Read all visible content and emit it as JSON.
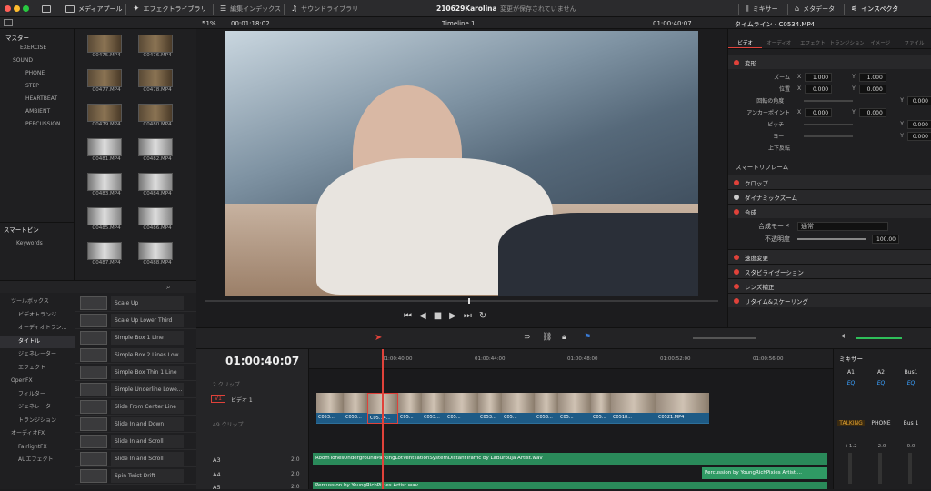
{
  "topbar": {
    "media_pool": "メディアプール",
    "effects_library": "エフェクトライブラリ",
    "edit_index": "編集インデックス",
    "sound_library": "サウンドライブラリ",
    "project_name": "210629Karolina",
    "save_status": "変更が保存されていません",
    "mixer": "ミキサー",
    "metadata": "メタデータ",
    "inspector": "インスペクタ"
  },
  "viewer": {
    "zoom": "51%",
    "source_timecode": "00:01:18:02",
    "timeline_name": "Timeline 1",
    "timecode": "01:00:40:07"
  },
  "inspector": {
    "title": "タイムライン - C0534.MP4",
    "tabs": [
      "ビデオ",
      "オーディオ",
      "エフェクト",
      "トランジション",
      "イメージ",
      "ファイル"
    ],
    "transform_label": "変形",
    "zoom_label": "ズーム",
    "zoom_x": "1.000",
    "zoom_y": "1.000",
    "position_label": "位置",
    "pos_x": "0.000",
    "pos_y": "0.000",
    "rotation_label": "回転の角度",
    "rotation": "0.000",
    "anchor_label": "アンカーポイント",
    "anchor_x": "0.000",
    "anchor_y": "0.000",
    "pitch_label": "ピッチ",
    "pitch": "0.000",
    "yaw_label": "ヨー",
    "yaw": "0.000",
    "flip_label": "上下反転",
    "smart_reframe": "スマートリフレーム",
    "crop": "クロップ",
    "dynamic_zoom": "ダイナミックズーム",
    "composite": "合成",
    "composite_mode_label": "合成モード",
    "composite_mode": "通常",
    "opacity_label": "不透明度",
    "opacity": "100.00",
    "speed_change": "速度変更",
    "stabilization": "スタビライゼーション",
    "lens_correction": "レンズ補正",
    "retime": "リタイム&スケーリング",
    "x_label": "X",
    "y_label": "Y"
  },
  "bins": {
    "master": "マスター",
    "items": [
      "EXERCISE",
      "SOUND",
      "PHONE",
      "STEP",
      "HEARTBEAT",
      "AMBIENT",
      "PERCUSSION"
    ],
    "smart_bins": "スマートビン",
    "keywords": "Keywords"
  },
  "media": [
    "C0475.MP4",
    "C0476.MP4",
    "C0477.MP4",
    "C0478.MP4",
    "C0479.MP4",
    "C0480.MP4",
    "C0481.MP4",
    "C0482.MP4",
    "C0483.MP4",
    "C0484.MP4",
    "C0485.MP4",
    "C0486.MP4",
    "C0487.MP4",
    "C0488.MP4"
  ],
  "fx_tree": [
    "ツールボックス",
    "ビデオトランジ...",
    "オーディオトラン...",
    "タイトル",
    "ジェネレーター",
    "エフェクト",
    "OpenFX",
    "フィルター",
    "ジェネレーター",
    "トランジション",
    "オーディオFX",
    "FairlightFX",
    "AUエフェクト"
  ],
  "fx_list": [
    "Scale Up",
    "Scale Up Lower Third",
    "Simple Box 1 Line Lowe...",
    "Simple Box 2 Lines Low...",
    "Simple Box Thin 1 Line ...",
    "Simple Underline Lowe...",
    "Slide From Center Line",
    "Slide In and Down",
    "Slide In and Scroll",
    "Slide In and Scroll Lowe...",
    "Spin Twist Drift"
  ],
  "timeline": {
    "timecode": "01:00:40:07",
    "ruler": [
      "01:00:40:00",
      "01:00:44:00",
      "01:00:48:00",
      "01:00:52:00",
      "01:00:56:00"
    ],
    "v2_clips": "2 クリップ",
    "v1_label": "V1",
    "v1_name": "ビデオ 1",
    "v1_clips": "49 クリップ",
    "video_clips": [
      "C053...",
      "C053...",
      "C05...4...",
      "C05...",
      "C053...",
      "C05...",
      "C053...",
      "C05...",
      "C053...",
      "C05...",
      "C05...",
      "C0518...",
      "C0521.MP4"
    ],
    "a3": "A3",
    "a4": "A4",
    "a5": "A5",
    "a3_clip": "RoomTonesUndergroundParkingLotVentilationSystemDistantTraffic by LaBurbuja Artist.wav",
    "a4_clip": "Percussion by YoungRichPixies Artist....",
    "a5_clip": "Percussion by YoungRichPixies Artist.wav",
    "vol": "2.0"
  },
  "mixer": {
    "title": "ミキサー",
    "channels": [
      "A1",
      "A2",
      "Bus1"
    ],
    "eq": "EQ",
    "channel_names": [
      "TALKING",
      "PHONE",
      "Bus 1"
    ],
    "levels": [
      "+1.2",
      "-2.0",
      "0.0"
    ]
  }
}
